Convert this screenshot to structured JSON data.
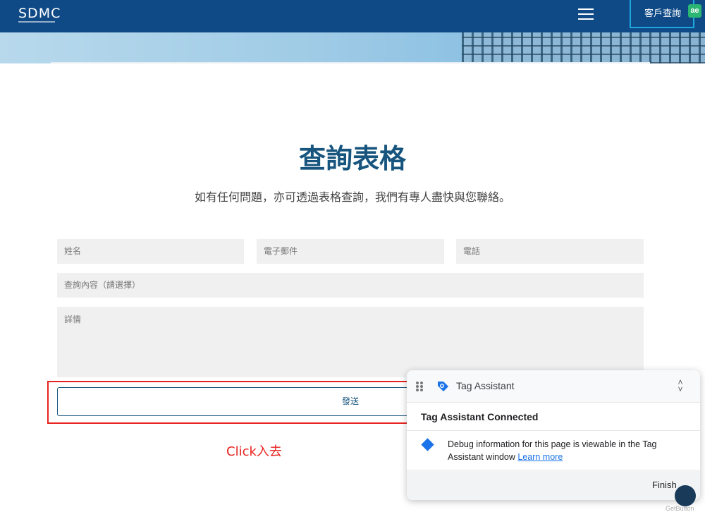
{
  "header": {
    "logo": "SDMC",
    "client_button_label": "客戶查詢",
    "extension_icon_label": "ae"
  },
  "main": {
    "title": "查詢表格",
    "subtitle": "如有任何問題，亦可透過表格查詢，我們有專人盡快與您聯絡。"
  },
  "form": {
    "name_placeholder": "姓名",
    "email_placeholder": "電子郵件",
    "phone_placeholder": "電話",
    "inquiry_type_placeholder": "查詢內容（請選擇）",
    "details_placeholder": "詳情",
    "submit_label": "發送"
  },
  "annotation": {
    "click_note": "Click入去",
    "highlight_color": "#e8231f"
  },
  "tag_assistant": {
    "title": "Tag Assistant",
    "connected_text": "Tag Assistant Connected",
    "message": "Debug information for this page is viewable in the Tag Assistant window",
    "learn_more": "Learn more",
    "finish_label": "Finish"
  },
  "widget": {
    "label": "GetButton"
  },
  "colors": {
    "header_bg": "#0f4a86",
    "title": "#17557e",
    "accent": "#1ea8e0"
  }
}
